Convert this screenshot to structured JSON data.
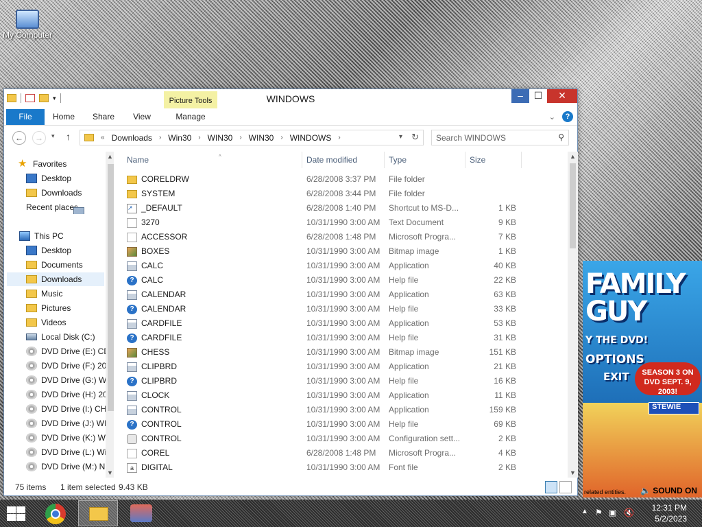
{
  "desktop": {
    "my_computer_label": "My Computer"
  },
  "poster": {
    "brand_line1": "FAMILY",
    "brand_line2": "GUY",
    "line_dvd": "Y THE DVD!",
    "line_options": "OPTIONS",
    "line_exit": "EXIT",
    "season": "SEASON 3 ON DVD SEPT. 9, 2003!",
    "menu_item": "STEWIE",
    "sound": "SOUND ON",
    "footer": "related entities."
  },
  "window": {
    "title": "WINDOWS",
    "contextual_tab_group": "Picture Tools",
    "tabs": {
      "file": "File",
      "home": "Home",
      "share": "Share",
      "view": "View",
      "manage": "Manage"
    },
    "address": {
      "prefix": "«",
      "crumbs": [
        "Downloads",
        "Win30",
        "WIN30",
        "WIN30",
        "WINDOWS"
      ]
    },
    "search_placeholder": "Search WINDOWS",
    "nav": {
      "favorites": "Favorites",
      "fav_items": [
        "Desktop",
        "Downloads",
        "Recent places"
      ],
      "this_pc": "This PC",
      "pc_items": [
        "Desktop",
        "Documents",
        "Downloads",
        "Music",
        "Pictures",
        "Videos",
        "Local Disk (C:)",
        "DVD Drive (E:) CD",
        "DVD Drive (F:) 20",
        "DVD Drive (G:) W",
        "DVD Drive (H:) 20",
        "DVD Drive (I:) CH",
        "DVD Drive (J:) WI",
        "DVD Drive (K:) W",
        "DVD Drive (L:) Wi",
        "DVD Drive (M:) N"
      ]
    },
    "columns": {
      "name": "Name",
      "date": "Date modified",
      "type": "Type",
      "size": "Size"
    },
    "files": [
      {
        "name": "CORELDRW",
        "date": "6/28/2008 3:37 PM",
        "type": "File folder",
        "size": "",
        "icon": "folder"
      },
      {
        "name": "SYSTEM",
        "date": "6/28/2008 3:44 PM",
        "type": "File folder",
        "size": "",
        "icon": "folder"
      },
      {
        "name": "_DEFAULT",
        "date": "6/28/2008 1:40 PM",
        "type": "Shortcut to MS-D...",
        "size": "1 KB",
        "icon": "link"
      },
      {
        "name": "3270",
        "date": "10/31/1990 3:00 AM",
        "type": "Text Document",
        "size": "9 KB",
        "icon": "doc"
      },
      {
        "name": "ACCESSOR",
        "date": "6/28/2008 1:48 PM",
        "type": "Microsoft Progra...",
        "size": "7 KB",
        "icon": "doc"
      },
      {
        "name": "BOXES",
        "date": "10/31/1990 3:00 AM",
        "type": "Bitmap image",
        "size": "1 KB",
        "icon": "bmp"
      },
      {
        "name": "CALC",
        "date": "10/31/1990 3:00 AM",
        "type": "Application",
        "size": "40 KB",
        "icon": "app"
      },
      {
        "name": "CALC",
        "date": "10/31/1990 3:00 AM",
        "type": "Help file",
        "size": "22 KB",
        "icon": "help"
      },
      {
        "name": "CALENDAR",
        "date": "10/31/1990 3:00 AM",
        "type": "Application",
        "size": "63 KB",
        "icon": "app"
      },
      {
        "name": "CALENDAR",
        "date": "10/31/1990 3:00 AM",
        "type": "Help file",
        "size": "33 KB",
        "icon": "help"
      },
      {
        "name": "CARDFILE",
        "date": "10/31/1990 3:00 AM",
        "type": "Application",
        "size": "53 KB",
        "icon": "app"
      },
      {
        "name": "CARDFILE",
        "date": "10/31/1990 3:00 AM",
        "type": "Help file",
        "size": "31 KB",
        "icon": "help"
      },
      {
        "name": "CHESS",
        "date": "10/31/1990 3:00 AM",
        "type": "Bitmap image",
        "size": "151 KB",
        "icon": "bmp"
      },
      {
        "name": "CLIPBRD",
        "date": "10/31/1990 3:00 AM",
        "type": "Application",
        "size": "21 KB",
        "icon": "app"
      },
      {
        "name": "CLIPBRD",
        "date": "10/31/1990 3:00 AM",
        "type": "Help file",
        "size": "16 KB",
        "icon": "help"
      },
      {
        "name": "CLOCK",
        "date": "10/31/1990 3:00 AM",
        "type": "Application",
        "size": "11 KB",
        "icon": "app"
      },
      {
        "name": "CONTROL",
        "date": "10/31/1990 3:00 AM",
        "type": "Application",
        "size": "159 KB",
        "icon": "app"
      },
      {
        "name": "CONTROL",
        "date": "10/31/1990 3:00 AM",
        "type": "Help file",
        "size": "69 KB",
        "icon": "help"
      },
      {
        "name": "CONTROL",
        "date": "10/31/1990 3:00 AM",
        "type": "Configuration sett...",
        "size": "2 KB",
        "icon": "cfg"
      },
      {
        "name": "COREL",
        "date": "6/28/2008 1:48 PM",
        "type": "Microsoft Progra...",
        "size": "4 KB",
        "icon": "doc"
      },
      {
        "name": "DIGITAL",
        "date": "10/31/1990 3:00 AM",
        "type": "Font file",
        "size": "2 KB",
        "icon": "font"
      }
    ],
    "status": {
      "items": "75 items",
      "selected": "1 item selected",
      "selected_size": "9.43 KB"
    }
  },
  "taskbar": {
    "time": "12:31 PM",
    "date": "5/2/2023"
  },
  "colors": {
    "accent": "#1979ca",
    "close_red": "#c8342c",
    "folder": "#f3c74a",
    "contextual_tab": "#f4f1a4"
  }
}
